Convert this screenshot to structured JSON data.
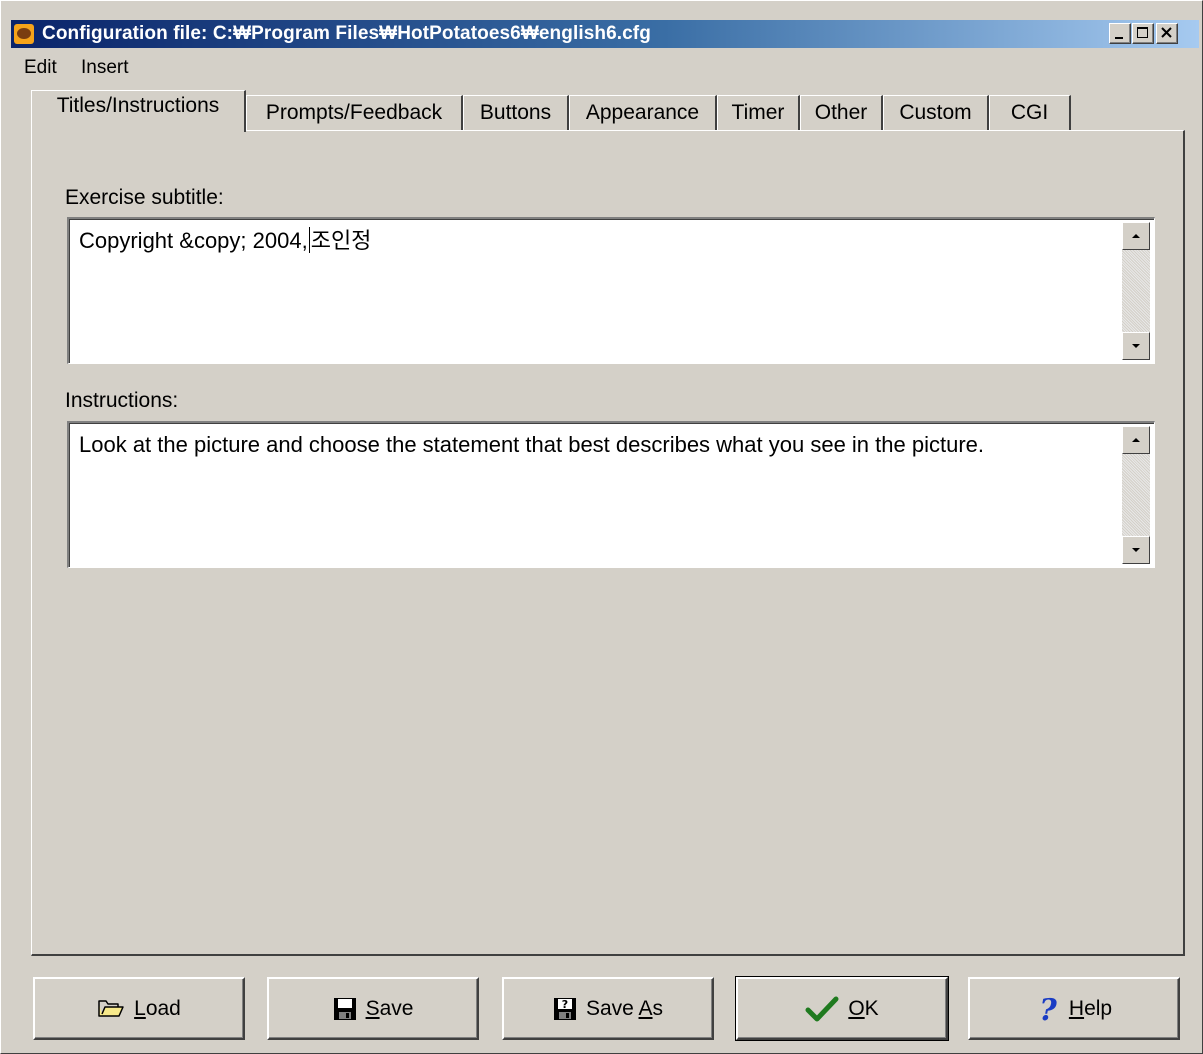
{
  "window": {
    "title": "Configuration file: C:₩Program Files₩HotPotatoes6₩english6.cfg"
  },
  "menu": {
    "items": [
      {
        "label": "Edit"
      },
      {
        "label": "Insert"
      }
    ]
  },
  "tabs": [
    {
      "label": "Titles/Instructions",
      "active": true
    },
    {
      "label": "Prompts/Feedback",
      "active": false
    },
    {
      "label": "Buttons",
      "active": false
    },
    {
      "label": "Appearance",
      "active": false
    },
    {
      "label": "Timer",
      "active": false
    },
    {
      "label": "Other",
      "active": false
    },
    {
      "label": "Custom",
      "active": false
    },
    {
      "label": "CGI",
      "active": false
    }
  ],
  "fields": {
    "subtitle": {
      "label": "Exercise subtitle:",
      "value_before_caret": "Copyright &copy; 2004,",
      "value_after_caret": "조인정"
    },
    "instructions": {
      "label": "Instructions:",
      "value": "Look at the picture and choose the statement that best describes what you see in the picture."
    }
  },
  "buttons": {
    "load": {
      "label_mnemonic": "L",
      "label_rest": "oad",
      "icon": "folder-open-icon"
    },
    "save": {
      "label_mnemonic": "S",
      "label_rest": "ave",
      "icon": "floppy-disk-icon"
    },
    "save_as": {
      "label_prefix": "Save ",
      "label_mnemonic": "A",
      "label_rest": "s",
      "icon": "floppy-disk-question-icon"
    },
    "ok": {
      "label_mnemonic": "O",
      "label_rest": "K",
      "icon": "checkmark-icon"
    },
    "help": {
      "label_mnemonic": "H",
      "label_rest": "elp",
      "icon": "question-mark-icon"
    }
  },
  "colors": {
    "title_gradient_start": "#0a246a",
    "title_gradient_end": "#a6caf0",
    "face": "#d4d0c8",
    "ok_check": "#1f7a1f",
    "help_question": "#1a3cc4"
  }
}
